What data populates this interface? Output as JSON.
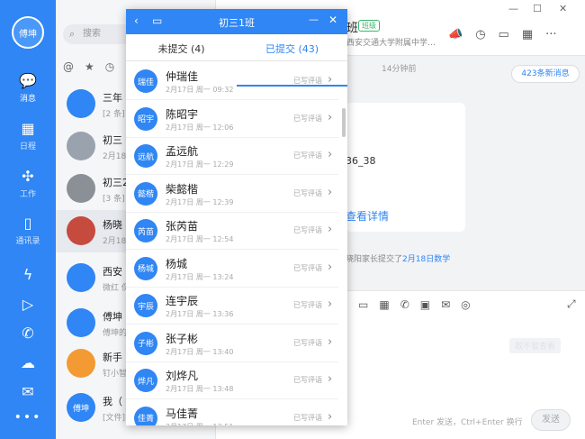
{
  "rail": {
    "avatar_text": "傅坤",
    "nav": [
      "消息",
      "日程",
      "工作",
      "通讯录"
    ]
  },
  "chatlist": {
    "search_placeholder": "搜索",
    "items": [
      {
        "avatar": "",
        "title": "三年",
        "sub": "[2 条]"
      },
      {
        "avatar": "",
        "title": "初三",
        "sub": "2月18"
      },
      {
        "avatar": "",
        "title": "初三2",
        "sub": "[3 条]"
      },
      {
        "avatar": "",
        "title": "杨晓",
        "sub": "2月18"
      },
      {
        "avatar": "",
        "title": "西安",
        "sub": "微红 保"
      },
      {
        "avatar": "",
        "title": "傅坤",
        "sub": "傅坤的"
      },
      {
        "avatar": "",
        "title": "新手",
        "sub": "钉小智"
      },
      {
        "avatar": "傅坤",
        "title": "我（",
        "sub": "[文件]"
      }
    ]
  },
  "chat": {
    "title_suffix": "班",
    "tag": "班级",
    "subtitle": "西安交通大学附属中学…",
    "time": "14分钟前",
    "new_messages": "423条新消息",
    "card_code": "36_38",
    "card_detail": "查看详情",
    "notice_prefix": "晓阳家长提交了",
    "notice_link": "2月18日数学",
    "input_ghost": "取不着查看",
    "input_hint": "Enter 发送，Ctrl+Enter 换行",
    "send_label": "发送"
  },
  "popup": {
    "title": "初三1班",
    "tab_unsubmitted": "未提交 (4)",
    "tab_submitted": "已提交 (43)",
    "rows": [
      {
        "avatar": "瑞佳",
        "name": "仲瑞佳",
        "date": "2月17日 周一 09:32",
        "status": "已写评语"
      },
      {
        "avatar": "昭宇",
        "name": "陈昭宇",
        "date": "2月17日 周一 12:06",
        "status": "已写评语"
      },
      {
        "avatar": "远航",
        "name": "孟远航",
        "date": "2月17日 周一 12:29",
        "status": "已写评语"
      },
      {
        "avatar": "懿楷",
        "name": "柴懿楷",
        "date": "2月17日 周一 12:39",
        "status": "已写评语"
      },
      {
        "avatar": "芮苗",
        "name": "张芮苗",
        "date": "2月17日 周一 12:54",
        "status": "已写评语"
      },
      {
        "avatar": "杨城",
        "name": "杨城",
        "date": "2月17日 周一 13:24",
        "status": "已写评语"
      },
      {
        "avatar": "宇辰",
        "name": "连宇辰",
        "date": "2月17日 周一 13:36",
        "status": "已写评语"
      },
      {
        "avatar": "子彬",
        "name": "张子彬",
        "date": "2月17日 周一 13:40",
        "status": "已写评语"
      },
      {
        "avatar": "烨凡",
        "name": "刘烨凡",
        "date": "2月17日 周一 13:48",
        "status": "已写评语"
      },
      {
        "avatar": "佳菁",
        "name": "马佳菁",
        "date": "2月17日 周一 13:51",
        "status": "已写评语"
      }
    ]
  }
}
